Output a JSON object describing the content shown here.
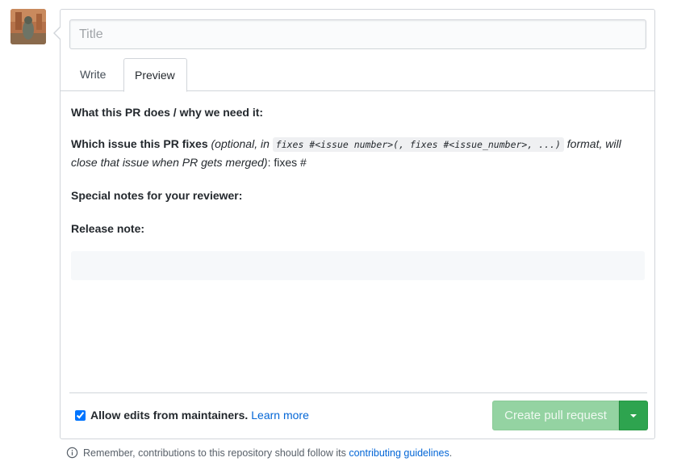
{
  "avatar": {
    "icon": "user-avatar"
  },
  "title_field": {
    "placeholder": "Title",
    "value": ""
  },
  "tabs": [
    {
      "label": "Write",
      "selected": false
    },
    {
      "label": "Preview",
      "selected": true
    }
  ],
  "preview": {
    "line1": "What this PR does / why we need it:",
    "line2": {
      "bold": "Which issue this PR fixes",
      "italic_before": "(optional, in",
      "code": "fixes #<issue number>(, fixes #<issue_number>, ...)",
      "italic_after": "format, will close that issue when PR gets merged)",
      "tail": ": fixes #"
    },
    "line3": "Special notes for your reviewer:",
    "line4": "Release note:"
  },
  "footer": {
    "allow_edits_checked": true,
    "allow_edits_label": "Allow edits from maintainers.",
    "learn_more": "Learn more",
    "create_button": "Create pull request",
    "create_button_color": "#94d3a2",
    "dropdown_color": "#2ea44f"
  },
  "notice": {
    "text": "Remember, contributions to this repository should follow its",
    "link": "contributing guidelines",
    "period": "."
  }
}
